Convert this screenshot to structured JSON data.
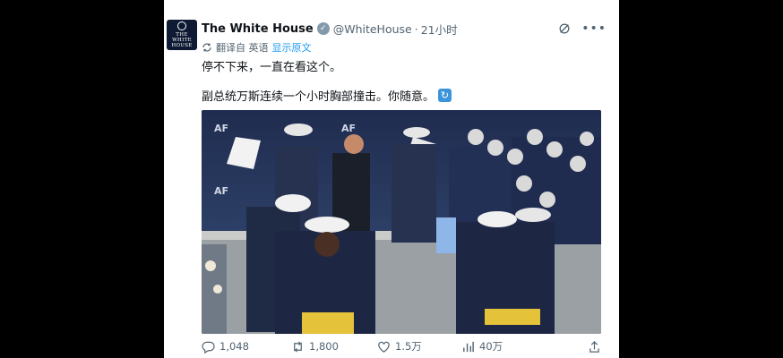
{
  "post": {
    "author_name": "The White House",
    "verified_mark": "✓",
    "handle": "@WhiteHouse",
    "separator": "·",
    "time": "21小时",
    "avatar_text_line1": "THE",
    "avatar_text_line2": "WHITE",
    "avatar_text_line3": "HOUSE",
    "translation_note": "翻译自 英语",
    "show_original_label": "显示原文",
    "text_line1": "停不下来，一直在看这个。",
    "text_line2": "副总统万斯连续一个小时胸部撞击。你随意。",
    "emoji_glyph": "🔁"
  },
  "actions": {
    "replies": "1,048",
    "reposts": "1,800",
    "likes": "1.5万",
    "views": "40万"
  },
  "icons": {
    "grok": "grok-icon",
    "more": "more-icon",
    "translate": "translate-icon",
    "reply": "reply-icon",
    "repost": "repost-icon",
    "like": "heart-icon",
    "views": "views-chart-icon",
    "share": "share-icon"
  },
  "colors": {
    "link": "#1d9bf0",
    "muted": "#536471",
    "text": "#0f1419",
    "verified_badge": "#829aab"
  }
}
